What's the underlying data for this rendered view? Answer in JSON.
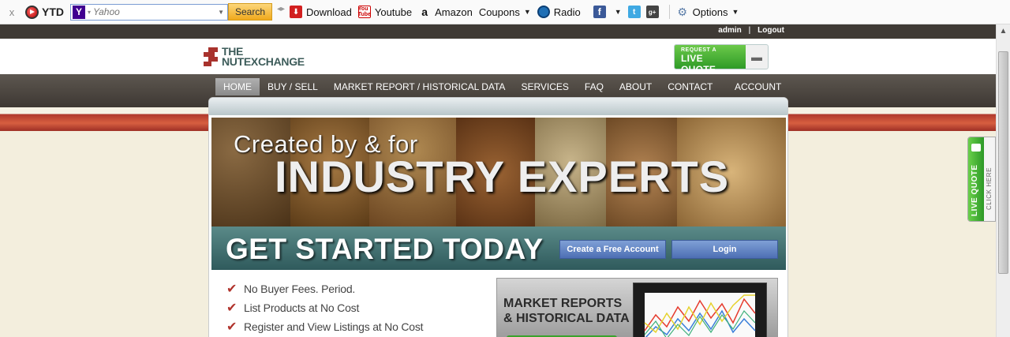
{
  "toolbar": {
    "close": "x",
    "brand": "YTD",
    "search_provider_letter": "Y",
    "search_placeholder": "Yahoo",
    "search_button": "Search",
    "items": [
      {
        "label": "Download",
        "icon": "download-icon"
      },
      {
        "label": "Youtube",
        "icon": "youtube-icon"
      },
      {
        "label": "Amazon",
        "icon": "amazon-icon"
      },
      {
        "label": "Coupons",
        "icon": ""
      },
      {
        "label": "Radio",
        "icon": "radio-icon"
      }
    ],
    "social": [
      "facebook-icon",
      "twitter-icon",
      "google-plus-icon"
    ],
    "options": "Options"
  },
  "site": {
    "top_links": {
      "admin": "admin",
      "separator": "|",
      "logout": "Logout"
    },
    "logo": {
      "line1": "THE",
      "line2": "NUTEXCHANGE"
    },
    "live_quote_button": {
      "small": "REQUEST A",
      "big": "LIVE QUOTE"
    },
    "nav": [
      "HOME",
      "BUY / SELL",
      "MARKET REPORT / HISTORICAL DATA",
      "SERVICES",
      "FAQ",
      "ABOUT",
      "CONTACT"
    ],
    "nav_active": "HOME",
    "nav_account": "ACCOUNT",
    "hero": {
      "small": "Created by & for",
      "big": "INDUSTRY EXPERTS"
    },
    "get_started": {
      "title": "GET STARTED TODAY",
      "create": "Create a Free Account",
      "login": "Login"
    },
    "features": [
      "No Buyer Fees. Period.",
      "List Products at No Cost",
      "Register and View Listings at No Cost"
    ],
    "market_box": {
      "line1": "MARKET REPORTS",
      "line2": "& HISTORICAL DATA"
    },
    "side_tab": {
      "live": "LIVE QUOTE",
      "click": "CLICK HERE"
    }
  },
  "colors": {
    "accent_red": "#b0392c",
    "brand_teal": "#3d5c5a",
    "quote_green": "#2e9b27",
    "nav_brown": "#3e3833"
  }
}
